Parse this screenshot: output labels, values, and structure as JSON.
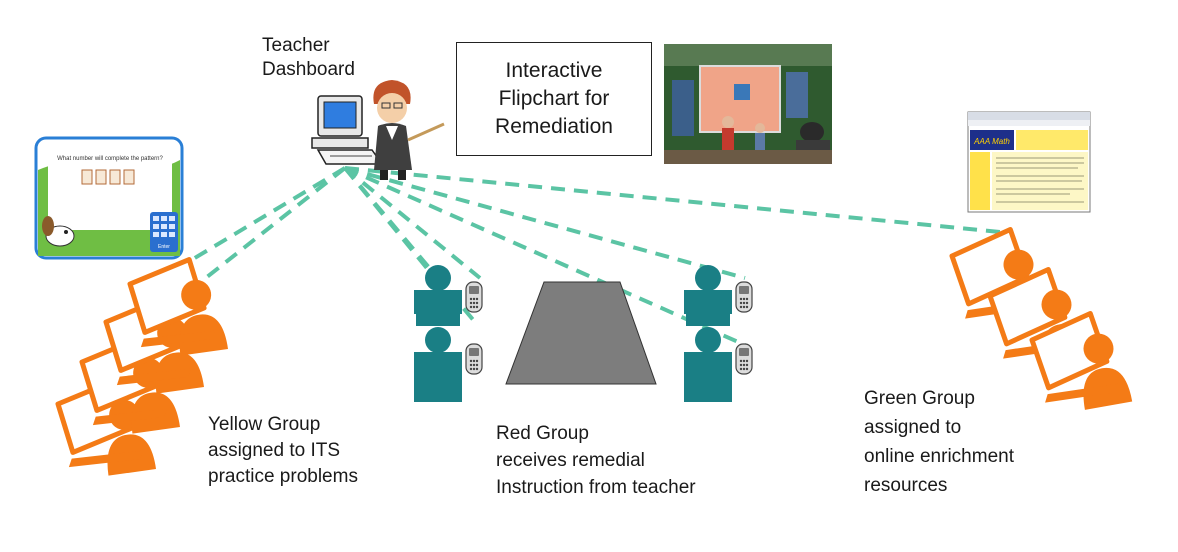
{
  "labels": {
    "teacher_dashboard": [
      "Teacher",
      "Dashboard"
    ],
    "flipchart": [
      "Interactive",
      "Flipchart for",
      "Remediation"
    ],
    "yellow_group": [
      "Yellow Group",
      "assigned to ITS",
      "practice problems"
    ],
    "red_group": [
      "Red Group",
      "receives remedial",
      "Instruction from teacher"
    ],
    "green_group": [
      "Green Group",
      "assigned to",
      "online enrichment",
      "resources"
    ]
  },
  "its_screenshot": {
    "question": "What number will complete the pattern?",
    "submit": "Enter"
  },
  "website_screenshot": {
    "logo_text": "AAA Math"
  },
  "colors": {
    "connector": "#5bc4a4",
    "orange_student": "#f47b16",
    "teal_student": "#1a7f85",
    "table": "#7d7d7d"
  }
}
